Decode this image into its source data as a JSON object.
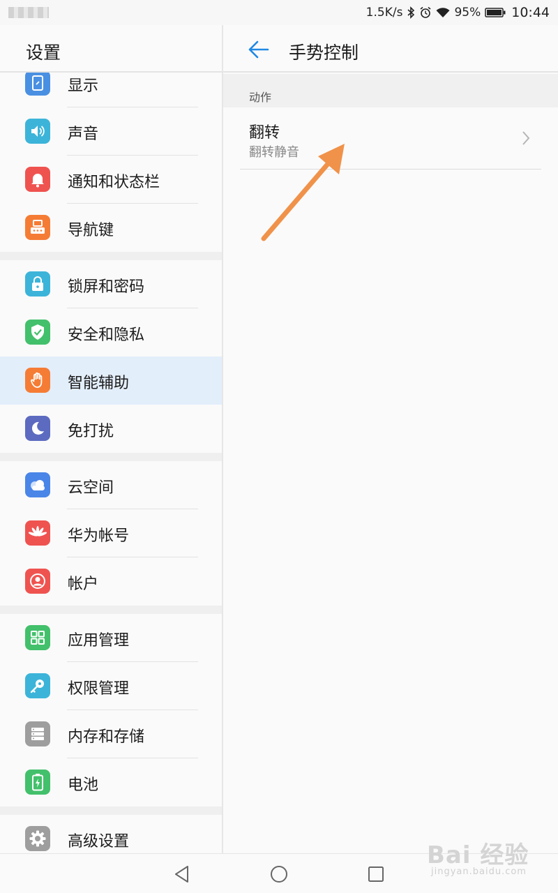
{
  "status_bar": {
    "network_speed": "1.5K/s",
    "battery_percent": "95%",
    "time": "10:44",
    "icons": [
      "bluetooth-icon",
      "alarm-icon",
      "wifi-icon",
      "battery-icon"
    ]
  },
  "left_panel": {
    "title": "设置",
    "items": [
      {
        "label": "显示",
        "icon": "display-icon",
        "color": "#4a90e2"
      },
      {
        "label": "声音",
        "icon": "speaker-icon",
        "color": "#3cb4d9"
      },
      {
        "label": "通知和状态栏",
        "icon": "bell-icon",
        "color": "#ef5350"
      },
      {
        "label": "导航键",
        "icon": "navigation-key-icon",
        "color": "#f57c35"
      },
      {
        "label": "锁屏和密码",
        "icon": "lock-icon",
        "color": "#3cb4d9"
      },
      {
        "label": "安全和隐私",
        "icon": "shield-check-icon",
        "color": "#43c06b"
      },
      {
        "label": "智能辅助",
        "icon": "hand-icon",
        "color": "#f57c35",
        "selected": true
      },
      {
        "label": "免打扰",
        "icon": "moon-icon",
        "color": "#5c6bc0"
      },
      {
        "label": "云空间",
        "icon": "cloud-icon",
        "color": "#4a86e8"
      },
      {
        "label": "华为帐号",
        "icon": "huawei-logo-icon",
        "color": "#ef5350"
      },
      {
        "label": "帐户",
        "icon": "user-icon",
        "color": "#ef5350"
      },
      {
        "label": "应用管理",
        "icon": "apps-grid-icon",
        "color": "#43c06b"
      },
      {
        "label": "权限管理",
        "icon": "key-icon",
        "color": "#3cb4d9"
      },
      {
        "label": "内存和存储",
        "icon": "storage-icon",
        "color": "#9e9e9e"
      },
      {
        "label": "电池",
        "icon": "battery-charge-icon",
        "color": "#43c06b"
      },
      {
        "label": "高级设置",
        "icon": "gear-icon",
        "color": "#9e9e9e"
      }
    ]
  },
  "right_panel": {
    "title": "手势控制",
    "section_label": "动作",
    "row": {
      "title": "翻转",
      "subtitle": "翻转静音"
    }
  },
  "annotation": {
    "arrow_color": "#f0924a"
  },
  "watermark": {
    "main": "Bai 经验",
    "sub": "jingyan.baidu.com"
  }
}
